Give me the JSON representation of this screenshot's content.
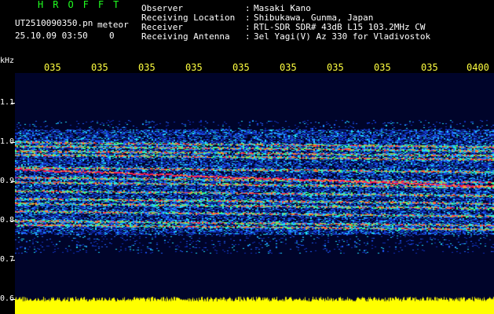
{
  "header": {
    "logo_text": "HROFFT",
    "filename": "UT2510090350.pn",
    "mode": "meteor",
    "datetime": "25.10.09 03:50",
    "counter": "0"
  },
  "meta": [
    {
      "key": "Observer",
      "value": "Masaki Kano"
    },
    {
      "key": "Receiving Location",
      "value": "Shibukawa, Gunma, Japan"
    },
    {
      "key": "Receiver",
      "value": "RTL-SDR SDR# 43dB L15 103.2MHz CW"
    },
    {
      "key": "Receiving Antenna",
      "value": "3el Yagi(V) Az 330 for Vladivostok"
    }
  ],
  "x_axis": {
    "labels": [
      "035",
      "035",
      "035",
      "035",
      "035",
      "035",
      "035",
      "035",
      "035",
      "0400"
    ]
  },
  "y_axis": {
    "unit": "kHz",
    "labels": [
      "1.1",
      "1.0",
      "0.9",
      "0.8",
      "0.7",
      "0.6"
    ]
  },
  "colors": {
    "title": "#20ff20",
    "axis_labels": "#ffff40",
    "background": "#00042a",
    "signal_level": "#ffff00"
  }
}
